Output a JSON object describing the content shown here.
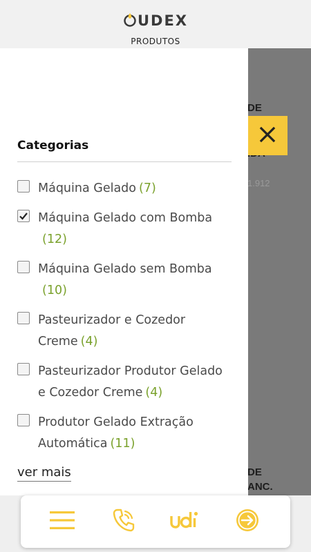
{
  "header": {
    "brand": "UDEX",
    "subtitle": "PRODUTOS"
  },
  "background_fragments": {
    "t1": "DE",
    "t2": "IDA",
    "t3": "1.912",
    "t4": "DE",
    "t5": "ANC."
  },
  "drawer": {
    "title": "Categorias",
    "categories": [
      {
        "name": "Máquina Gelado",
        "count": "(7)",
        "checked": false
      },
      {
        "name": "Máquina Gelado com Bomba",
        "count": "(12)",
        "checked": true
      },
      {
        "name": "Máquina Gelado sem Bomba",
        "count": "(10)",
        "checked": false
      },
      {
        "name_line1": "Pasteurizador e Cozedor",
        "name_line2": "Creme",
        "count": "(4)",
        "checked": false
      },
      {
        "name_line1": "Pasteurizador Produtor Gelado",
        "name_line2": "e Cozedor Creme",
        "count": "(4)",
        "checked": false
      },
      {
        "name_line1": "Produtor Gelado Extração",
        "name_line2": "Automática",
        "count": "(11)",
        "checked": false
      }
    ],
    "more_label": "ver mais"
  },
  "bottom_nav": {
    "items": [
      {
        "icon": "menu-icon"
      },
      {
        "icon": "phone-icon"
      },
      {
        "icon": "udi-logo-icon",
        "label": "UDI"
      },
      {
        "icon": "arrow-right-circle-icon"
      }
    ]
  },
  "colors": {
    "accent_yellow": "#f6c83a",
    "count_green": "#7aa12c",
    "overlay_gray": "#7a7a7a"
  }
}
